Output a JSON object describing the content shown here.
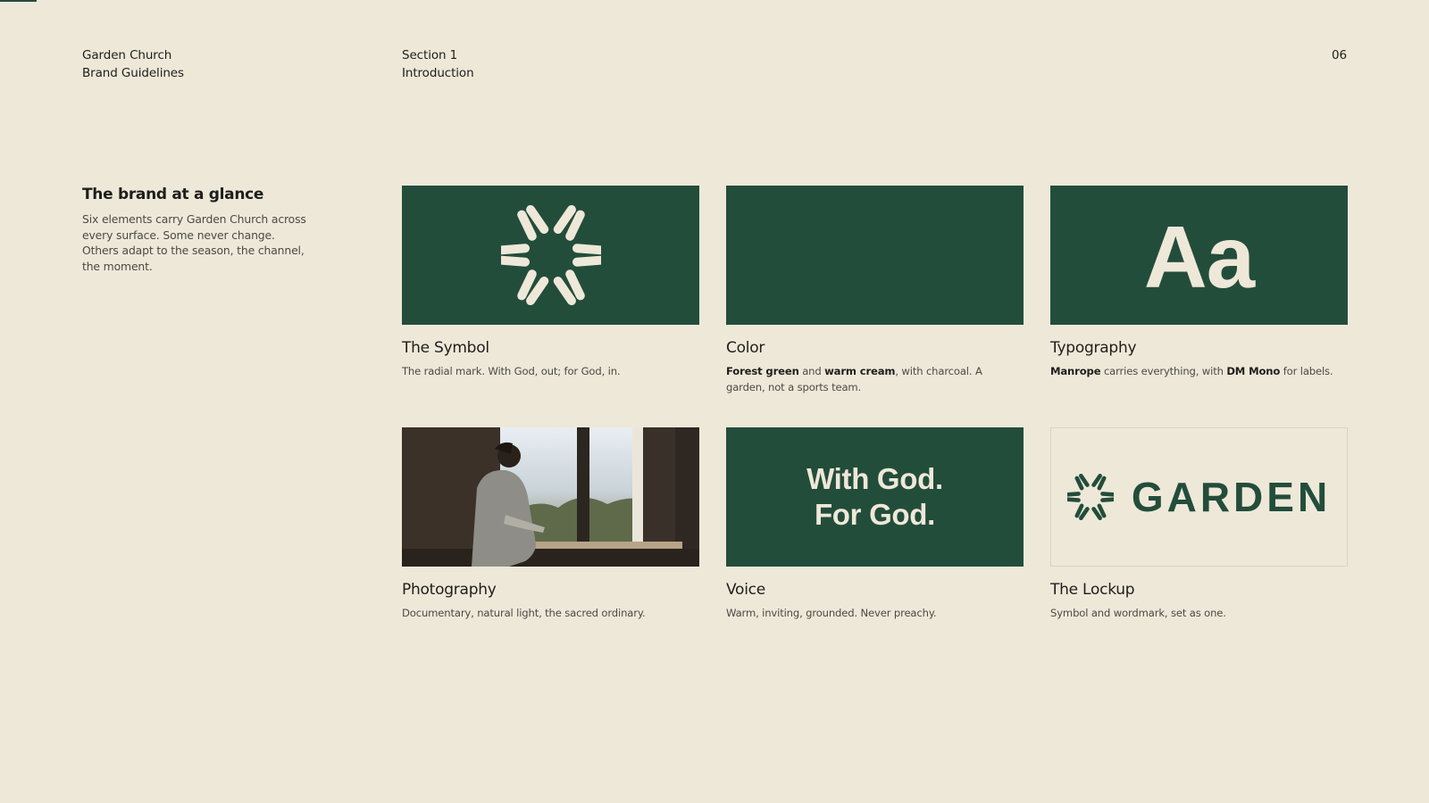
{
  "header": {
    "brand_line1": "Garden Church",
    "brand_line2": "Brand Guidelines",
    "section_line1": "Section 1",
    "section_line2": "Introduction",
    "page_number": "06"
  },
  "intro": {
    "title": "The brand at a glance",
    "body": "Six elements carry Garden Church across every surface. Some never change. Others adapt to the season, the channel, the moment."
  },
  "cards": {
    "symbol": {
      "title": "The Symbol",
      "desc": "The radial mark. With God, out; for God, in.",
      "icon": "radial-mark-icon"
    },
    "color": {
      "title": "Color",
      "desc_bold1": "Forest green",
      "desc_mid": " and ",
      "desc_bold2": "warm cream",
      "desc_rest": ", with charcoal. A garden, not a sports team."
    },
    "typography": {
      "title": "Typography",
      "specimen": "Aa",
      "desc_bold1": "Manrope",
      "desc_mid": " carries everything, with ",
      "desc_bold2": "DM Mono",
      "desc_rest": " for labels."
    },
    "photography": {
      "title": "Photography",
      "desc": "Documentary, natural light, the sacred ordinary."
    },
    "voice": {
      "title": "Voice",
      "line1": "With God.",
      "line2": "For God.",
      "desc": "Warm, inviting, grounded. Never preachy."
    },
    "lockup": {
      "title": "The Lockup",
      "wordmark": "GARDEN",
      "desc": "Symbol and wordmark, set as one."
    }
  },
  "colors": {
    "forest_green": "#234D3B",
    "warm_cream": "#EEE8D9",
    "charcoal": "#1E1E1B"
  }
}
